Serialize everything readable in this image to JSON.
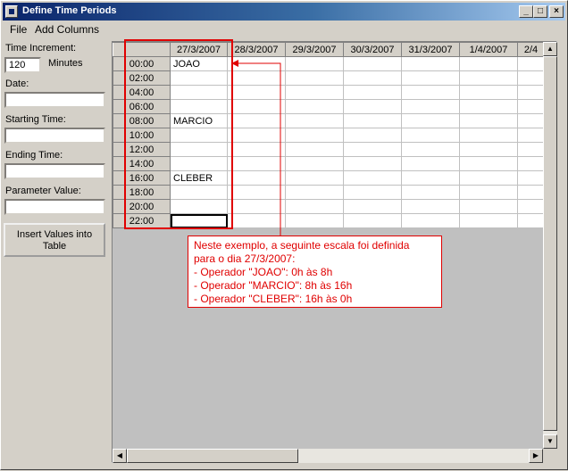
{
  "window": {
    "title": "Define Time Periods",
    "controls": {
      "minimize": "_",
      "maximize": "□",
      "close": "×"
    }
  },
  "menu": {
    "file": "File",
    "add_columns": "Add Columns"
  },
  "left_panel": {
    "time_increment_label": "Time Increment:",
    "time_increment_value": "120",
    "minutes_label": "Minutes",
    "date_label": "Date:",
    "date_value": "",
    "starting_time_label": "Starting Time:",
    "starting_time_value": "",
    "ending_time_label": "Ending Time:",
    "ending_time_value": "",
    "parameter_value_label": "Parameter Value:",
    "parameter_value_value": "",
    "insert_button_line1": "Insert Values into",
    "insert_button_line2": "Table"
  },
  "grid": {
    "columns": [
      "27/3/2007",
      "28/3/2007",
      "29/3/2007",
      "30/3/2007",
      "31/3/2007",
      "1/4/2007",
      "2/4"
    ],
    "rows": [
      "00:00",
      "02:00",
      "04:00",
      "06:00",
      "08:00",
      "10:00",
      "12:00",
      "14:00",
      "16:00",
      "18:00",
      "20:00",
      "22:00"
    ],
    "cells": [
      [
        "JOAO",
        "",
        "",
        "",
        "",
        "",
        ""
      ],
      [
        "",
        "",
        "",
        "",
        "",
        "",
        ""
      ],
      [
        "",
        "",
        "",
        "",
        "",
        "",
        ""
      ],
      [
        "",
        "",
        "",
        "",
        "",
        "",
        ""
      ],
      [
        "MARCIO",
        "",
        "",
        "",
        "",
        "",
        ""
      ],
      [
        "",
        "",
        "",
        "",
        "",
        "",
        ""
      ],
      [
        "",
        "",
        "",
        "",
        "",
        "",
        ""
      ],
      [
        "",
        "",
        "",
        "",
        "",
        "",
        ""
      ],
      [
        "CLEBER",
        "",
        "",
        "",
        "",
        "",
        ""
      ],
      [
        "",
        "",
        "",
        "",
        "",
        "",
        ""
      ],
      [
        "",
        "",
        "",
        "",
        "",
        "",
        ""
      ],
      [
        "",
        "",
        "",
        "",
        "",
        "",
        ""
      ]
    ],
    "selected_cell": {
      "row": 11,
      "col": 0
    }
  },
  "scrollbars": {
    "up": "▲",
    "down": "▼",
    "left": "◀",
    "right": "▶"
  },
  "annotation": {
    "color": "#e00000",
    "lines": [
      "Neste exemplo, a seguinte escala foi definida",
      "para o dia 27/3/2007:",
      "- Operador \"JOAO\": 0h às 8h",
      "- Operador \"MARCIO\": 8h às 16h",
      "- Operador \"CLEBER\": 16h às 0h"
    ]
  }
}
